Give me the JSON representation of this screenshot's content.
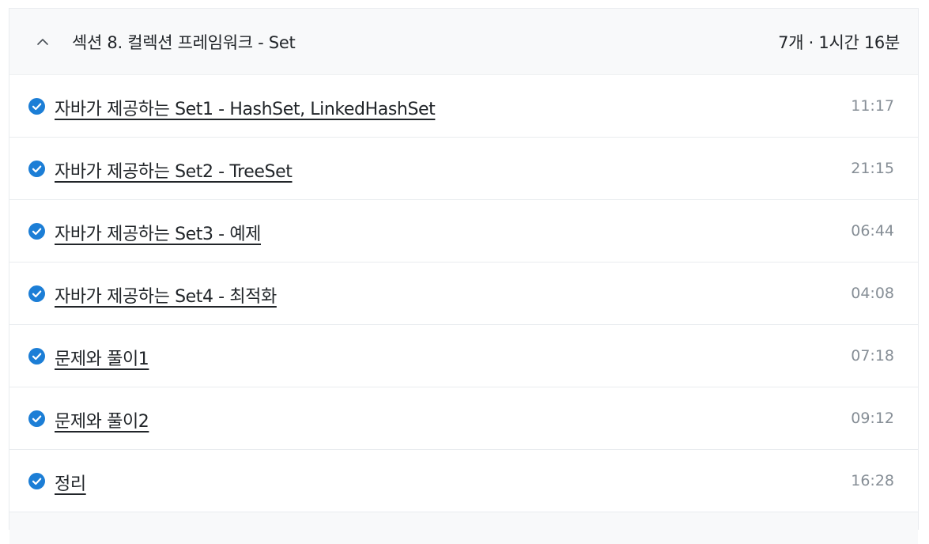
{
  "section": {
    "title": "섹션 8. 컬렉션 프레임워크 - Set",
    "meta": "7개 · 1시간 16분",
    "expanded": true,
    "chevron_icon": "chevron-up-icon"
  },
  "colors": {
    "check_blue": "#1c7ed6",
    "header_bg": "#f8f9fa",
    "text": "#212529",
    "muted": "#868e96"
  },
  "lessons": [
    {
      "title": "자바가 제공하는 Set1 - HashSet, LinkedHashSet",
      "duration": "11:17",
      "completed": true
    },
    {
      "title": "자바가 제공하는 Set2 - TreeSet",
      "duration": "21:15",
      "completed": true
    },
    {
      "title": "자바가 제공하는 Set3 - 예제",
      "duration": "06:44",
      "completed": true
    },
    {
      "title": "자바가 제공하는 Set4 - 최적화",
      "duration": "04:08",
      "completed": true
    },
    {
      "title": "문제와 풀이1",
      "duration": "07:18",
      "completed": true
    },
    {
      "title": "문제와 풀이2",
      "duration": "09:12",
      "completed": true
    },
    {
      "title": "정리",
      "duration": "16:28",
      "completed": true
    }
  ]
}
